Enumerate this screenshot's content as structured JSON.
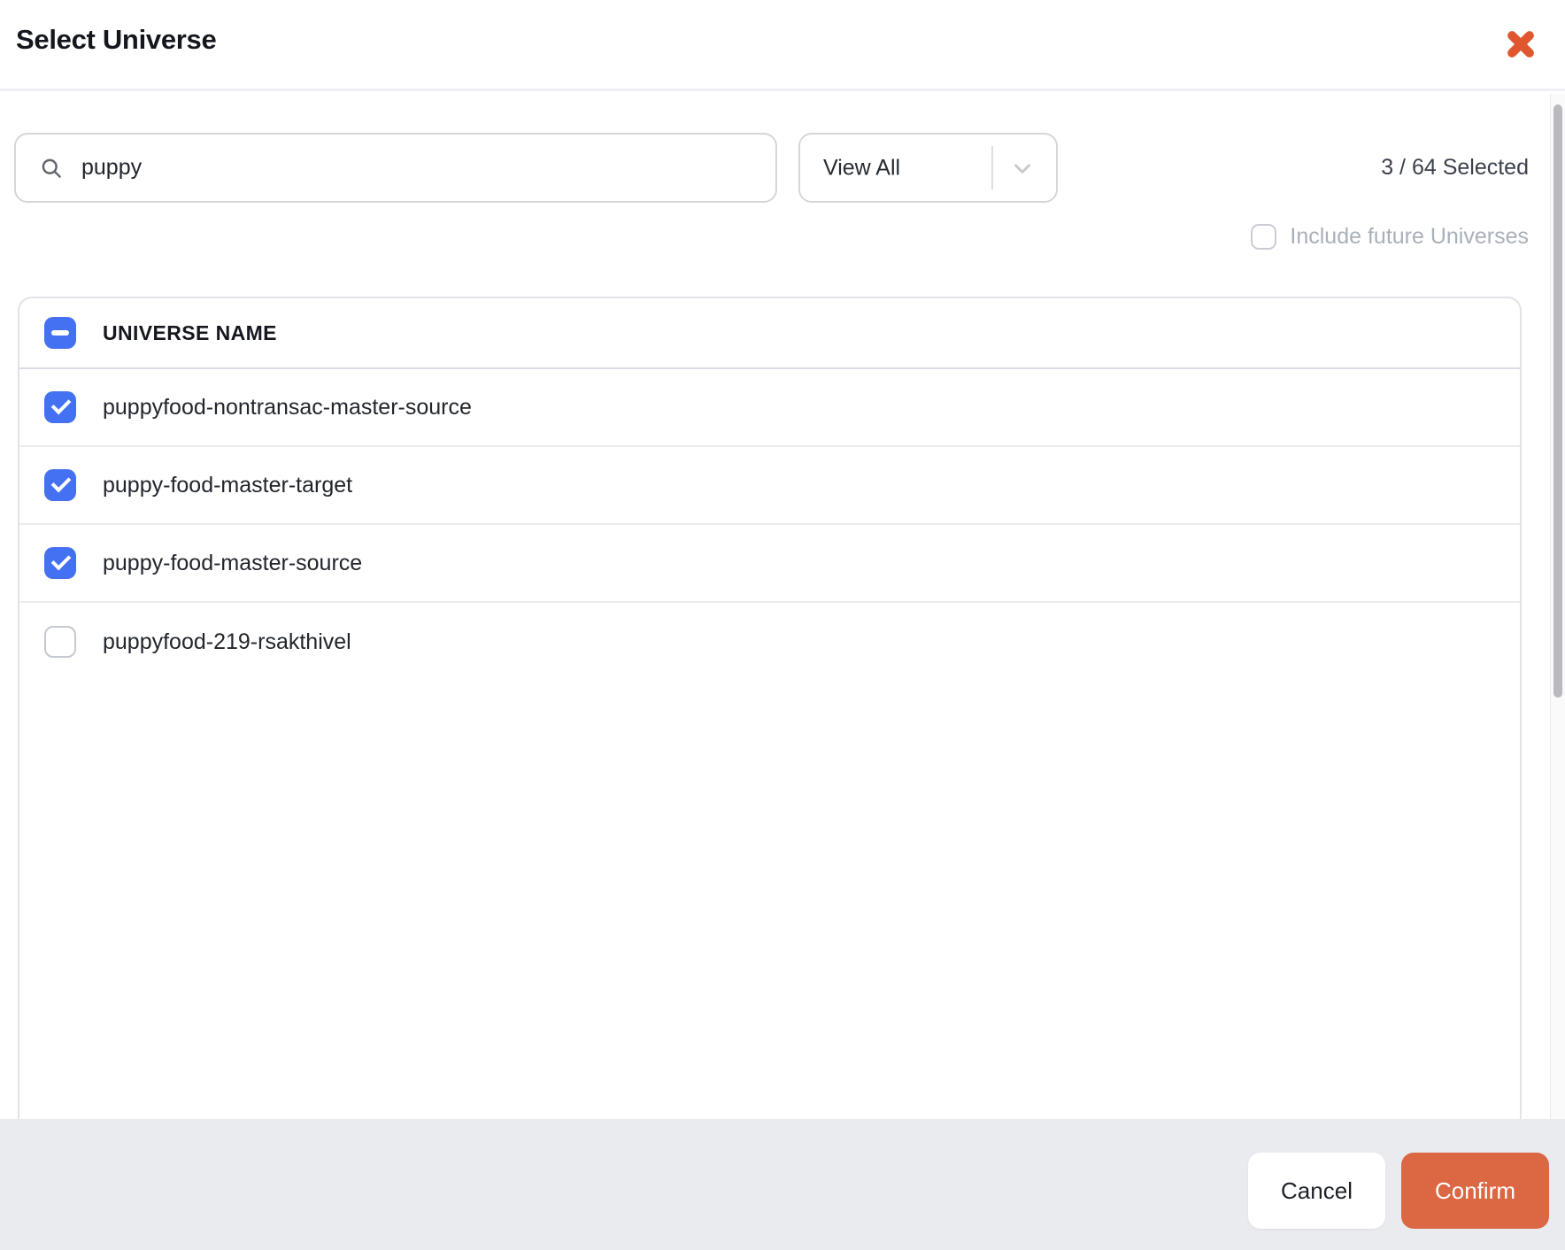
{
  "colors": {
    "confirm_orange": "#DB6743",
    "close_orange": "#E0572F",
    "checkbox_blue": "#4371F2",
    "muted_text": "#A9B0BA",
    "footer_bg": "#E9EBEF"
  },
  "header": {
    "title": "Select Universe",
    "close_icon": "x-mark"
  },
  "toolbar": {
    "search_value": "puppy",
    "search_icon": "magnifier",
    "view_filter_value": "View All",
    "view_filter_icon": "chevron-down",
    "selected_count": "3 / 64 Selected",
    "include_future_label": "Include future Universes",
    "include_future_checked": false
  },
  "table": {
    "header_label": "UNIVERSE NAME",
    "select_all_state": "indeterminate",
    "rows": [
      {
        "name": "puppyfood-nontransac-master-source",
        "checked": true
      },
      {
        "name": "puppy-food-master-target",
        "checked": true
      },
      {
        "name": "puppy-food-master-source",
        "checked": true
      },
      {
        "name": "puppyfood-219-rsakthivel",
        "checked": false
      }
    ]
  },
  "footer": {
    "cancel_label": "Cancel",
    "confirm_label": "Confirm"
  }
}
